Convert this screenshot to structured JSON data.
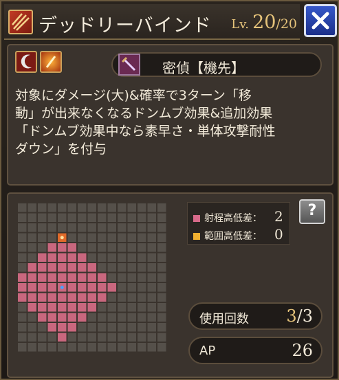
{
  "header": {
    "title": "デッドリーバインド",
    "level_label": "Lv.",
    "level_current": "20",
    "level_max": "/20"
  },
  "icons": {
    "skill_type": "claw-slash-icon",
    "weapon": "crescent-blade-icon",
    "element": "fire-icon",
    "job": "dagger-icon",
    "close": "close-icon",
    "help": "question-icon"
  },
  "info": {
    "job_name": "密偵【機先】",
    "description_lines": [
      "対象にダメージ(大)&確率で3ターン「移",
      "動」が出来なくなるドンムブ効果&追加効果",
      "「ドンムブ効果中なら素早さ・単体攻撃耐性",
      "ダウン」を付与"
    ]
  },
  "range": {
    "grid_size": 15,
    "center": [
      4,
      8
    ],
    "radius": 5,
    "height_range_label": "射程高低差：",
    "height_range_value": "2",
    "height_area_label": "範囲高低差：",
    "height_area_value": "0",
    "help_label": "?"
  },
  "stats": {
    "uses_label": "使用回数",
    "uses_current": "3",
    "uses_max": "/3",
    "ap_label": "AP",
    "ap_value": "26"
  },
  "colors": {
    "range_cell": "#c9677e",
    "grid_cell": "#55504a",
    "target_marker": "#e06a2a",
    "center_dot": "#4aa0ff",
    "legend_range": "#d76a8a",
    "legend_area": "#f0b030",
    "accent": "#e5c37a"
  }
}
